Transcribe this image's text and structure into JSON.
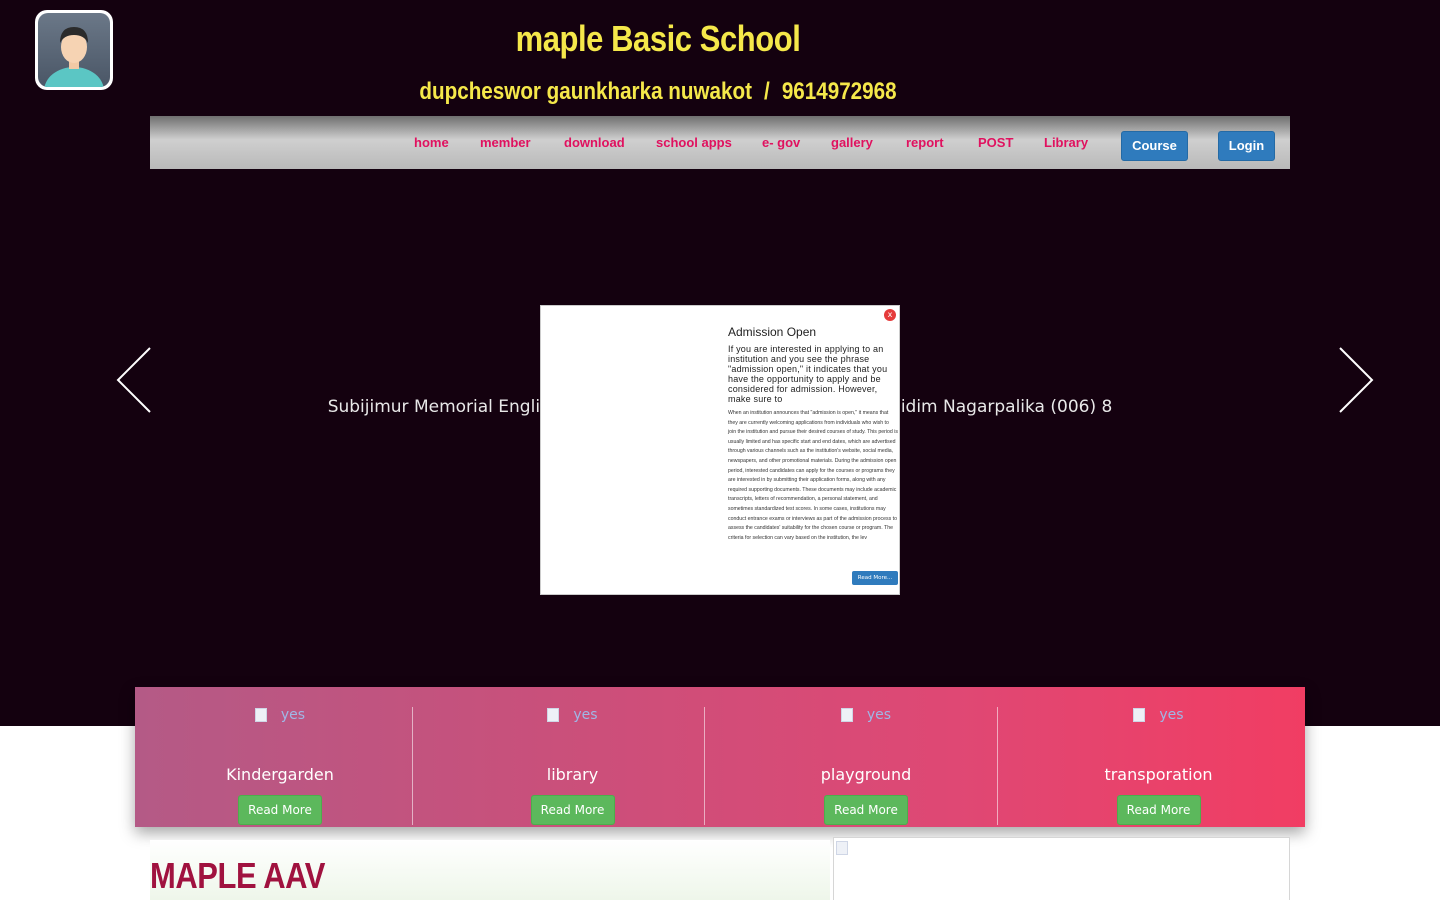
{
  "header": {
    "school_name": "maple Basic School",
    "address": "dupcheswor gaunkharka nuwakot",
    "separator": "/",
    "phone": "9614972968",
    "avatar_icon": "user-avatar-icon"
  },
  "nav": {
    "items": [
      "home",
      "member",
      "download",
      "school apps",
      "e- gov",
      "gallery",
      "report",
      "POST",
      "Library"
    ],
    "course_label": "Course",
    "login_label": "Login"
  },
  "slider": {
    "caption": "Subijimur Memorial English School, Bhimdatta Nagarpalika (006) 8",
    "caption_left": "Subijimur Memorial Engli",
    "caption_right": "hidim Nagarpalika (006) 8",
    "prev_icon": "chevron-left-icon",
    "next_icon": "chevron-right-icon"
  },
  "modal": {
    "close_label": "x",
    "title": "Admission Open",
    "lead": "If you are interested in applying to an institution and you see the phrase \"admission open,\" it indicates that you have the opportunity to apply and be considered for admission. However, make sure to",
    "body": "When an institution announces that \"admission is open,\" it means that they are currently welcoming applications from individuals who wish to join the institution and pursue their desired courses of study. This period is usually limited and has specific start and end dates, which are advertised through various channels such as the institution's website, social media, newspapers, and other promotional materials. During the admission open period, interested candidates can apply for the courses or programs they are interested in by submitting their application forms, along with any required supporting documents. These documents may include academic transcripts, letters of recommendation, a personal statement, and sometimes standardized test scores. In some cases, institutions may conduct entrance exams or interviews as part of the admission process to assess the candidates' suitability for the chosen course or program. The criteria for selection can vary based on the institution, the lev",
    "read_more": "Read More..."
  },
  "features": [
    {
      "img_alt": "yes",
      "title": "Kindergarden",
      "button": "Read More"
    },
    {
      "img_alt": "yes",
      "title": "library",
      "button": "Read More"
    },
    {
      "img_alt": "yes",
      "title": "playground",
      "button": "Read More"
    },
    {
      "img_alt": "yes",
      "title": "transporation",
      "button": "Read More"
    }
  ],
  "section": {
    "title": "MAPLE AAV"
  },
  "colors": {
    "hero_bg": "#14010f",
    "header_text": "#f5e84a",
    "nav_link": "#e0115f",
    "button_blue": "#2f7bbd",
    "button_green": "#5cb85c",
    "section_title": "#a0123f"
  }
}
